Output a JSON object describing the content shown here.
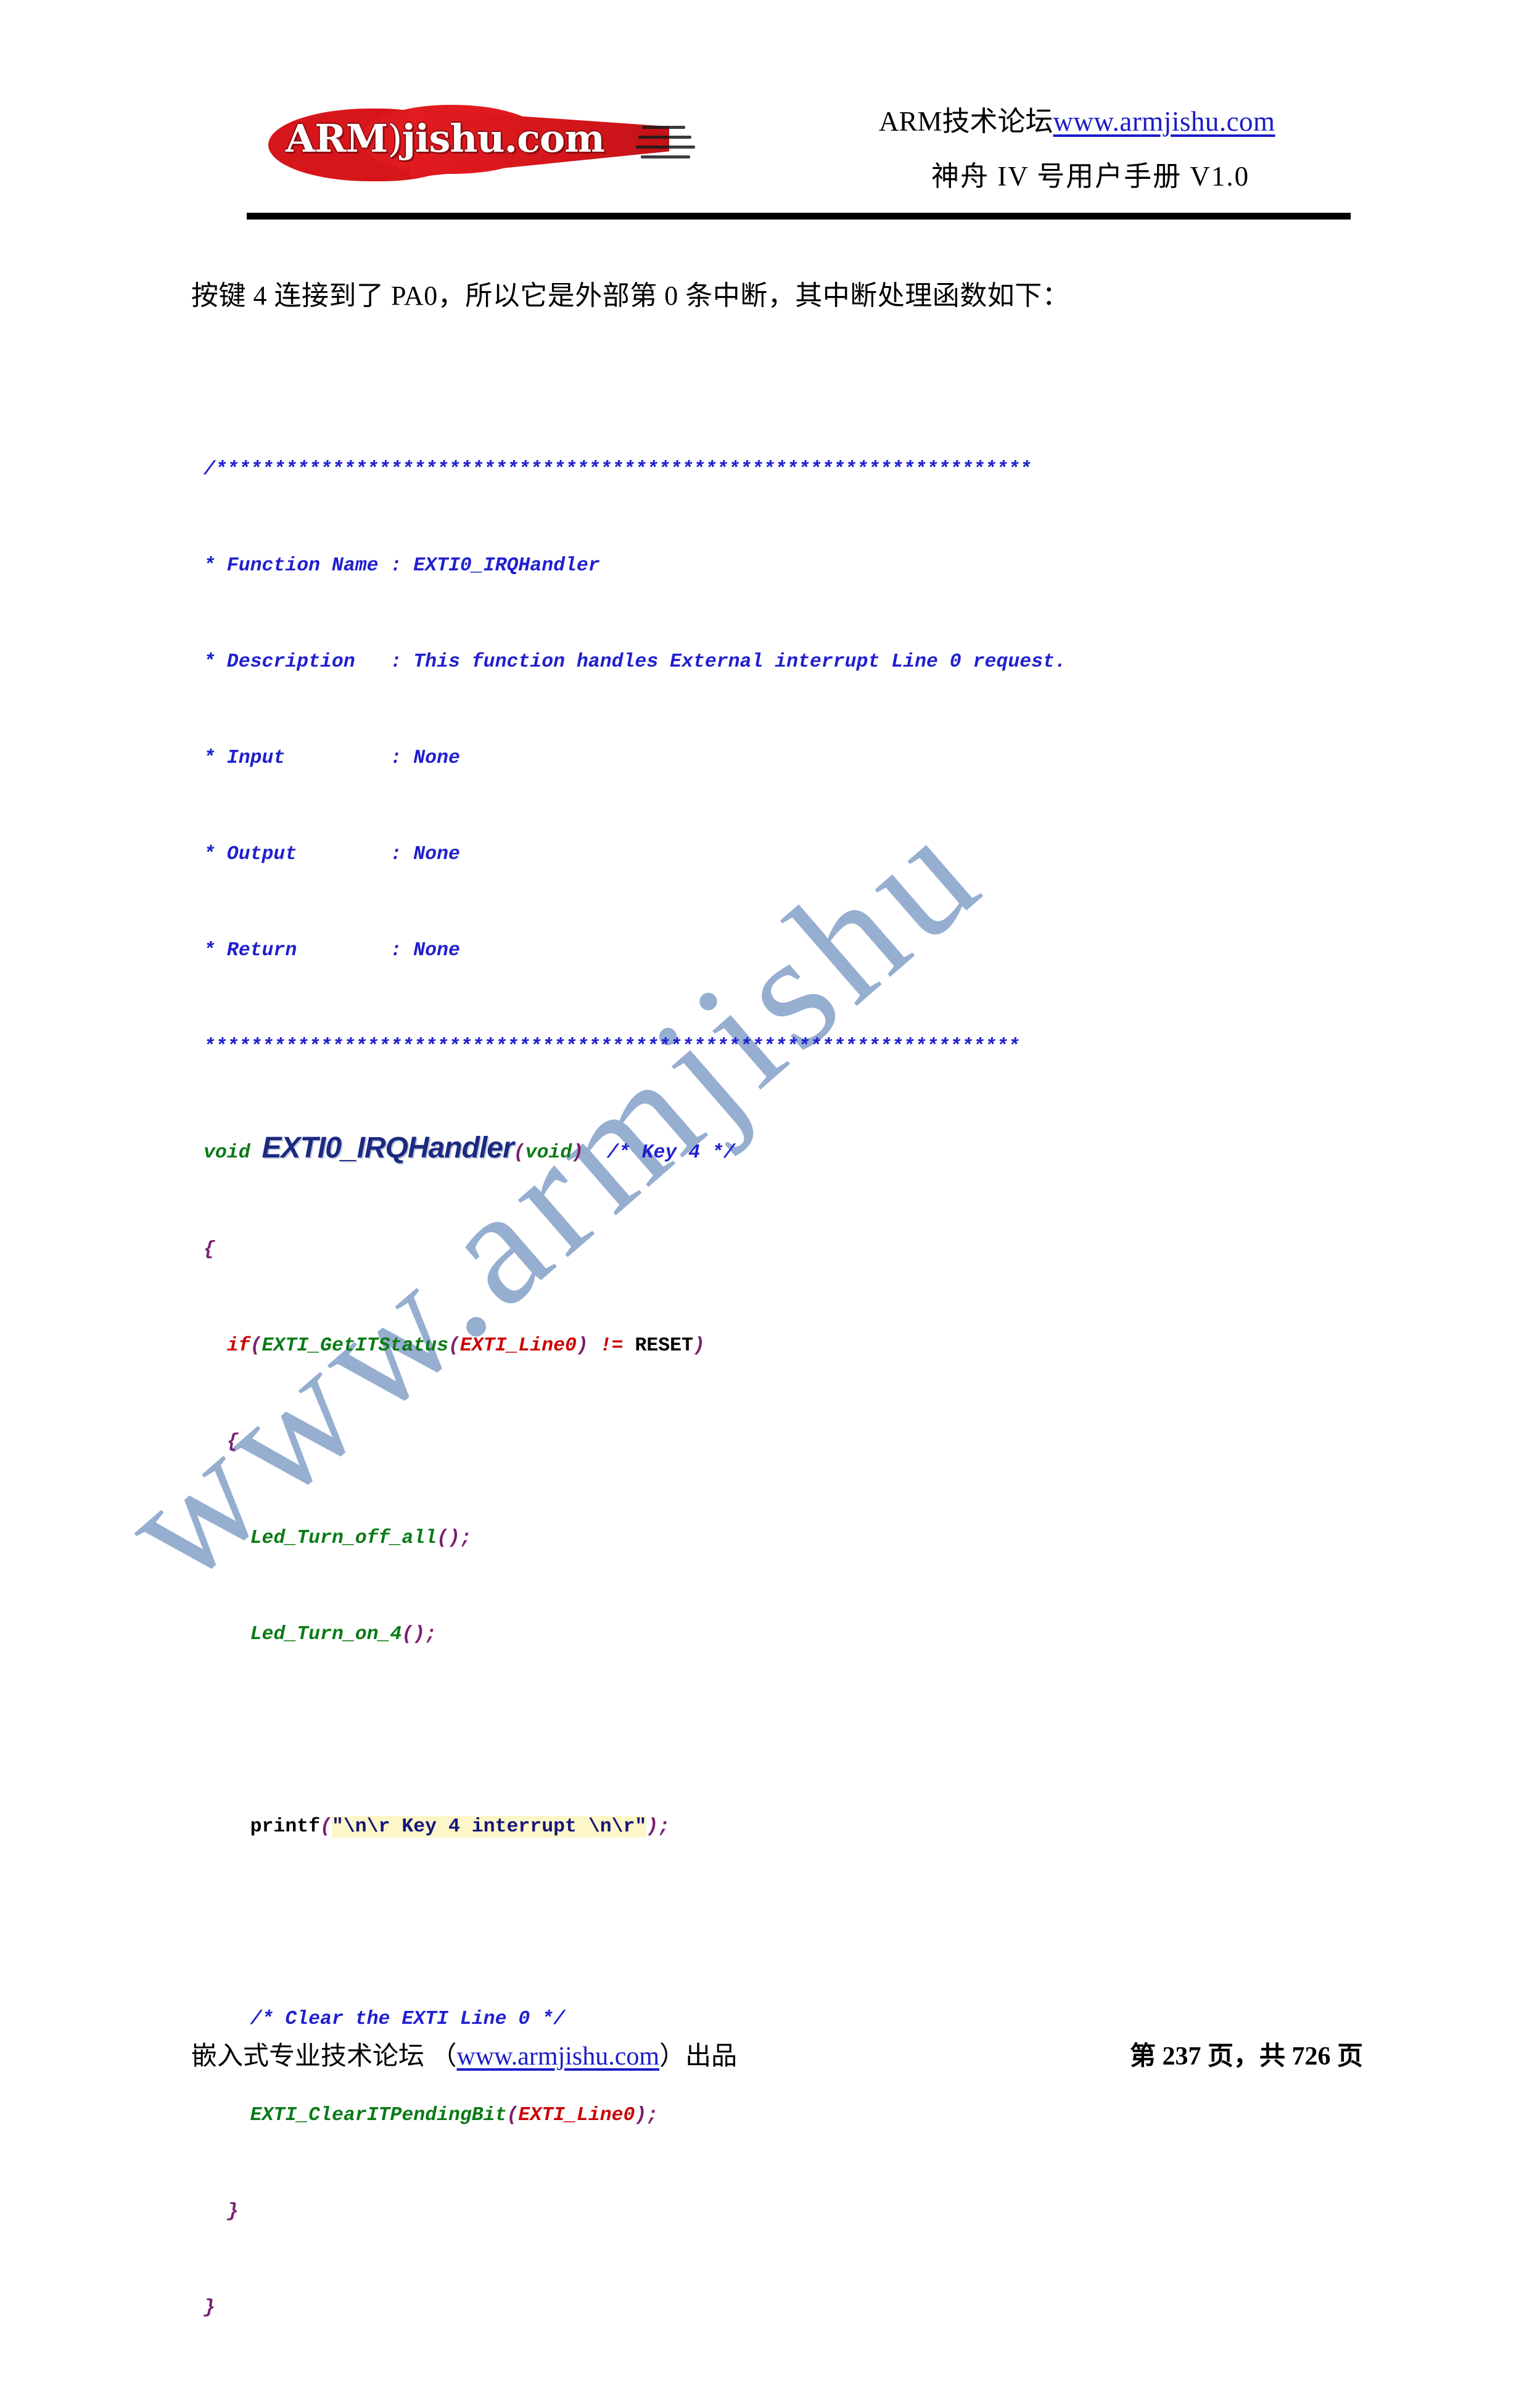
{
  "header": {
    "logo_text_main": "ARM",
    "logo_text_paren": ")",
    "logo_text_sub": "jishu.com",
    "logo_alt": "ARM)jishu.com",
    "title_cn": "ARM技术论坛",
    "title_link": "www.armjishu.com",
    "subtitle": "神舟 IV 号用户手册 V1.0"
  },
  "intro": {
    "paragraph": "按键 4 连接到了 PA0，所以它是外部第 0 条中断，其中断处理函数如下："
  },
  "code": {
    "banner_top": "/**********************************************************************",
    "banner_bottom": "**********************************************************************",
    "comment_rows": [
      {
        "label": "* Function Name ",
        "colon": ": ",
        "value": "EXTI0_IRQHandler"
      },
      {
        "label": "* Description   ",
        "colon": ": ",
        "value": "This function handles External interrupt Line 0 request."
      },
      {
        "label": "* Input         ",
        "colon": ": ",
        "value": "None"
      },
      {
        "label": "* Output        ",
        "colon": ": ",
        "value": "None"
      },
      {
        "label": "* Return        ",
        "colon": ": ",
        "value": "None"
      }
    ],
    "signature": {
      "return_type": "void",
      "name": "EXTI0_IRQHandler",
      "open_paren": "(",
      "param": "void",
      "close_paren": ")",
      "trailing_comment": "/* Key 4 */"
    },
    "brace_open_fn": "{",
    "if_stmt": {
      "keyword": "if",
      "open_paren": "(",
      "func": "EXTI_GetITStatus",
      "arg_open": "(",
      "arg": "EXTI_Line0",
      "arg_close": ")",
      "operator": "!=",
      "rhs": "RESET",
      "close_paren": ")"
    },
    "brace_open_if": "{",
    "calls": [
      {
        "name": "Led_Turn_off_all",
        "parens": "();"
      },
      {
        "name": "Led_Turn_on_4",
        "parens": "();"
      }
    ],
    "printf": {
      "name": "printf",
      "open_paren": "(",
      "string": "\"\\n\\r Key 4 interrupt \\n\\r\"",
      "close_paren": ")",
      "semicolon": ";"
    },
    "clear_comment": "/* Clear the EXTI Line 0 */",
    "clear_call": {
      "func": "EXTI_ClearITPendingBit",
      "open_paren": "(",
      "arg": "EXTI_Line0",
      "close_paren": ")",
      "semicolon": ";"
    },
    "brace_close_if": "}",
    "brace_close_fn": "}"
  },
  "watermark": {
    "text": "www.armjishu",
    "color": "#6f8fbe"
  },
  "footer": {
    "left_prefix": "嵌入式专业技术论坛 （",
    "left_link": "www.armjishu.com",
    "left_suffix": "）出品",
    "page_text": "第 237 页，共 726 页"
  },
  "colors": {
    "comment_blue": "#1f1fd0",
    "keyword_red": "#cc0000",
    "function_green": "#0a7a16",
    "punctuation_purple": "#7a1e6e",
    "string_navy": "#15157a",
    "string_highlight": "#fdf6c8",
    "logo_red": "#d7161c",
    "link_blue": "#1b1bc8"
  }
}
